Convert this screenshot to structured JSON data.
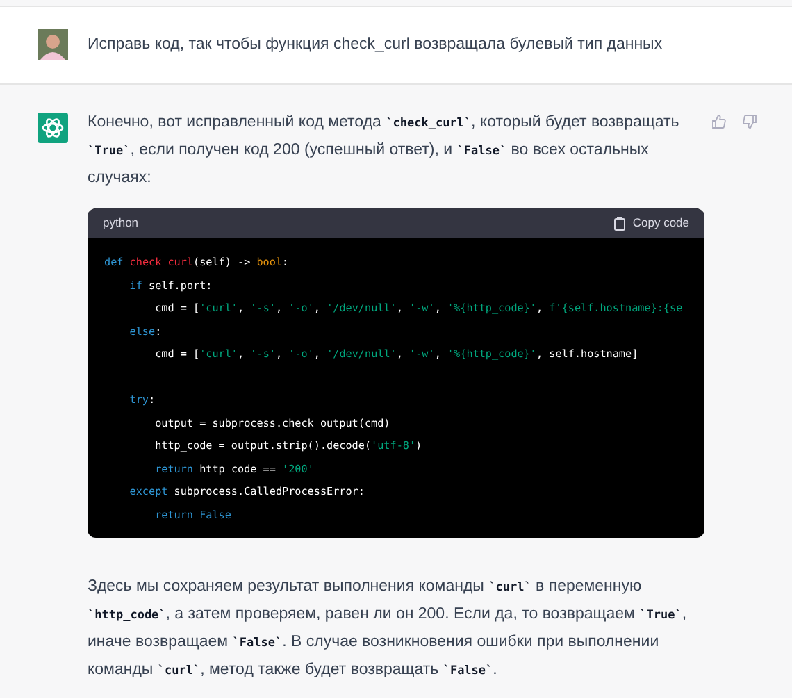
{
  "user_message": {
    "text": "Исправь код, так чтобы функция check_curl возвращала булевый тип данных"
  },
  "assistant_message": {
    "intro": [
      {
        "kind": "text",
        "text": "Конечно, вот исправленный код метода "
      },
      {
        "kind": "code",
        "text": "`check_curl`"
      },
      {
        "kind": "text",
        "text": ", который будет возвращать "
      },
      {
        "kind": "code",
        "text": "`True`"
      },
      {
        "kind": "text",
        "text": ", если получен код 200 (успешный ответ), и "
      },
      {
        "kind": "code",
        "text": "`False`"
      },
      {
        "kind": "text",
        "text": " во всех остальных случаях:"
      }
    ],
    "code_block": {
      "language": "python",
      "copy_label": "Copy code",
      "sections": [
        [
          [
            {
              "kind": "keyword",
              "text": "def "
            },
            {
              "kind": "function",
              "text": "check_curl"
            },
            {
              "kind": "plain",
              "text": "(self) -> "
            },
            {
              "kind": "builtin",
              "text": "bool"
            },
            {
              "kind": "plain",
              "text": ":"
            }
          ],
          [
            {
              "kind": "keyword",
              "text": "    if"
            },
            {
              "kind": "plain",
              "text": " self.port:"
            }
          ],
          [
            {
              "kind": "plain",
              "text": "        cmd = ["
            },
            {
              "kind": "string",
              "text": "'curl'"
            },
            {
              "kind": "plain",
              "text": ", "
            },
            {
              "kind": "string",
              "text": "'-s'"
            },
            {
              "kind": "plain",
              "text": ", "
            },
            {
              "kind": "string",
              "text": "'-o'"
            },
            {
              "kind": "plain",
              "text": ", "
            },
            {
              "kind": "string",
              "text": "'/dev/null'"
            },
            {
              "kind": "plain",
              "text": ", "
            },
            {
              "kind": "string",
              "text": "'-w'"
            },
            {
              "kind": "plain",
              "text": ", "
            },
            {
              "kind": "string",
              "text": "'%{http_code}'"
            },
            {
              "kind": "plain",
              "text": ", "
            },
            {
              "kind": "string",
              "text": "f'{self.hostname}:{se"
            }
          ],
          [
            {
              "kind": "keyword",
              "text": "    else"
            },
            {
              "kind": "plain",
              "text": ":"
            }
          ],
          [
            {
              "kind": "plain",
              "text": "        cmd = ["
            },
            {
              "kind": "string",
              "text": "'curl'"
            },
            {
              "kind": "plain",
              "text": ", "
            },
            {
              "kind": "string",
              "text": "'-s'"
            },
            {
              "kind": "plain",
              "text": ", "
            },
            {
              "kind": "string",
              "text": "'-o'"
            },
            {
              "kind": "plain",
              "text": ", "
            },
            {
              "kind": "string",
              "text": "'/dev/null'"
            },
            {
              "kind": "plain",
              "text": ", "
            },
            {
              "kind": "string",
              "text": "'-w'"
            },
            {
              "kind": "plain",
              "text": ", "
            },
            {
              "kind": "string",
              "text": "'%{http_code}'"
            },
            {
              "kind": "plain",
              "text": ", self.hostname]"
            }
          ]
        ],
        [
          [
            {
              "kind": "keyword",
              "text": "    try"
            },
            {
              "kind": "plain",
              "text": ":"
            }
          ],
          [
            {
              "kind": "plain",
              "text": "        output = subprocess.check_output(cmd)"
            }
          ],
          [
            {
              "kind": "plain",
              "text": "        http_code = output.strip().decode("
            },
            {
              "kind": "string",
              "text": "'utf-8'"
            },
            {
              "kind": "plain",
              "text": ")"
            }
          ],
          [
            {
              "kind": "keyword",
              "text": "        return"
            },
            {
              "kind": "plain",
              "text": " http_code == "
            },
            {
              "kind": "string",
              "text": "'200'"
            }
          ],
          [
            {
              "kind": "keyword",
              "text": "    except"
            },
            {
              "kind": "plain",
              "text": " subprocess.CalledProcessError:"
            }
          ],
          [
            {
              "kind": "keyword",
              "text": "        return False"
            }
          ]
        ]
      ]
    },
    "outro": [
      {
        "kind": "text",
        "text": "Здесь мы сохраняем результат выполнения команды "
      },
      {
        "kind": "code",
        "text": "`curl`"
      },
      {
        "kind": "text",
        "text": " в переменную "
      },
      {
        "kind": "code",
        "text": "`http_code`"
      },
      {
        "kind": "text",
        "text": ", а затем проверяем, равен ли он 200. Если да, то возвращаем "
      },
      {
        "kind": "code",
        "text": "`True`"
      },
      {
        "kind": "text",
        "text": ", иначе возвращаем "
      },
      {
        "kind": "code",
        "text": "`False`"
      },
      {
        "kind": "text",
        "text": ". В случае возникновения ошибки при выполнении команды "
      },
      {
        "kind": "code",
        "text": "`curl`"
      },
      {
        "kind": "text",
        "text": ", метод также будет возвращать "
      },
      {
        "kind": "code",
        "text": "`False`"
      },
      {
        "kind": "text",
        "text": "."
      }
    ]
  }
}
